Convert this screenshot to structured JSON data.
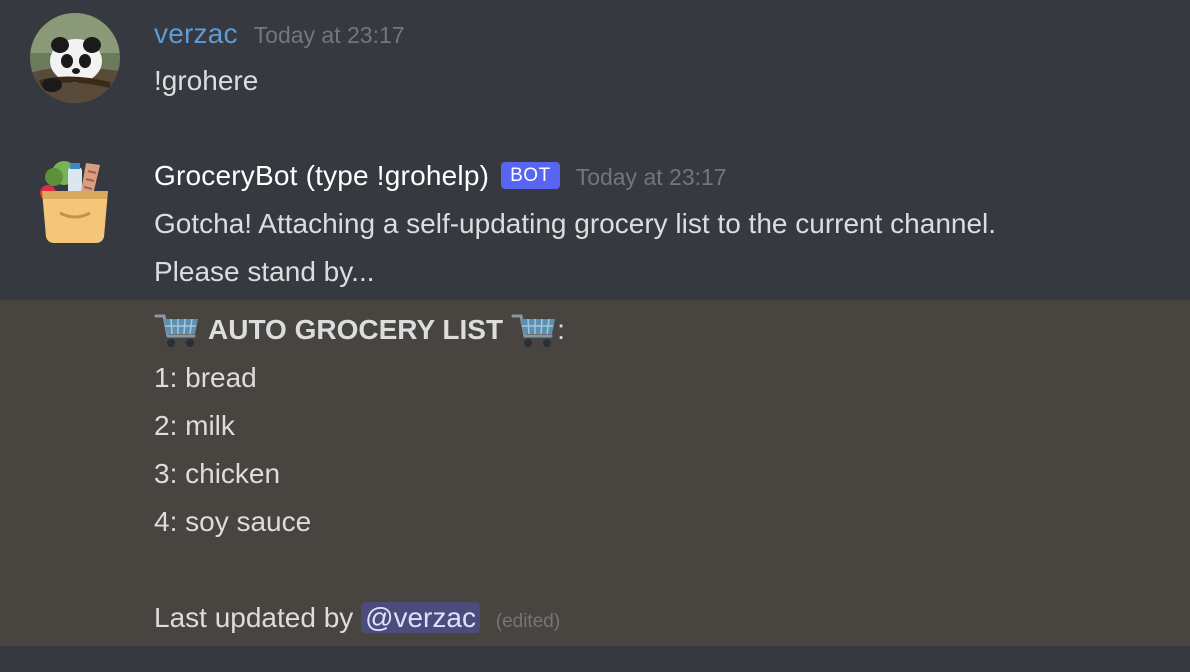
{
  "messages": [
    {
      "author": "verzac",
      "author_color": "#5c9bd6",
      "timestamp": "Today at 23:17",
      "lines": [
        "!grohere"
      ]
    },
    {
      "author": "GroceryBot (type !grohelp)",
      "author_color": "#ffffff",
      "badge": "BOT",
      "timestamp": "Today at 23:17",
      "lines": [
        "Gotcha! Attaching a self-updating grocery list to the current channel.",
        "Please stand by..."
      ]
    }
  ],
  "grocery_list": {
    "title": "AUTO GROCERY LIST",
    "title_suffix": ":",
    "items": [
      "1: bread",
      "2: milk",
      "3: chicken",
      "4: soy sauce"
    ],
    "footer_prefix": "Last updated by",
    "mention": "@verzac",
    "edited": "(edited)"
  },
  "icons": {
    "avatar_verzac": "panda-avatar-icon",
    "avatar_bot": "grocery-bag-avatar-icon",
    "cart": "shopping-cart-icon"
  }
}
